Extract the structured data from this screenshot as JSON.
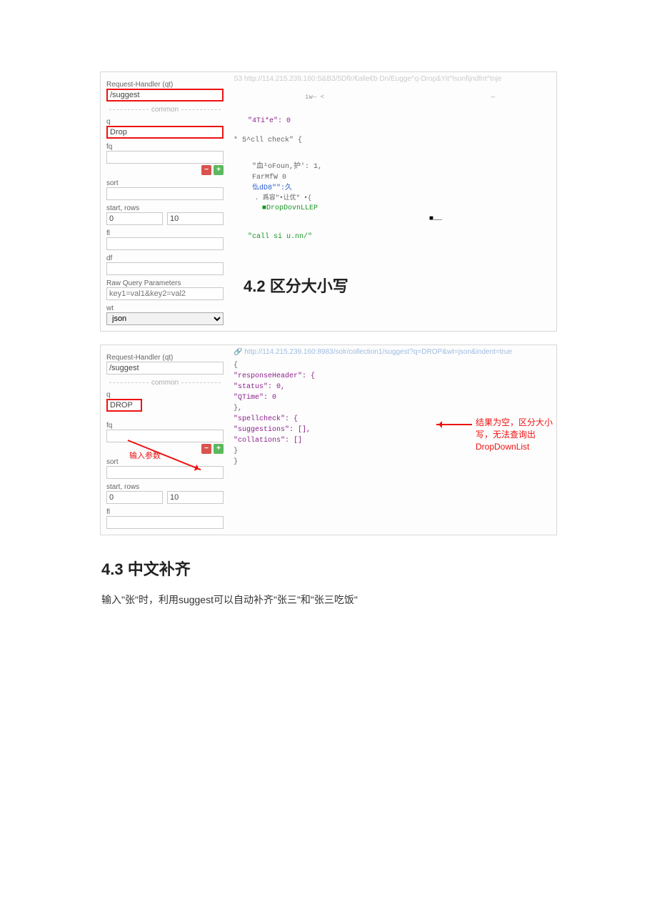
{
  "shot1": {
    "side": {
      "rh_label": "Request-Handler (qt)",
      "rh_value": "/suggest",
      "common": "common",
      "q_label": "q",
      "q_value": "Drop",
      "fq_label": "fq",
      "sort_label": "sort",
      "startrows_label": "start, rows",
      "start_value": "0",
      "rows_value": "10",
      "fl_label": "fl",
      "df_label": "df",
      "rawq_label": "Raw Query Parameters",
      "rawq_ph": "key1=val1&key2=val2",
      "wt_label": "wt",
      "wt_value": "json"
    },
    "right": {
      "url": "S3 http://114.215.239.160:S&B3/5Dflr/€alle€b Dn/Eugge^q-Drop&Yit^lsonfijndfnt^tnje",
      "line_iw": "iw— <",
      "line_dash": "—",
      "t4ti": "\"4Ti*e\":  0",
      "spellcheck": "* 5^cll check\" {",
      "xue": "\"血¹oFoun,护': 1,",
      "farmfw": "FarMfW 0",
      "fud": "仫dD8\"\":久",
      "sug": ". 爲容\"•让优\"  •{",
      "drop": "■DropDovnLLEP",
      "blk": "■……",
      "coll": "\"call si u.nn/\""
    },
    "h42": "4.2 区分大小写"
  },
  "shot2": {
    "side": {
      "rh_label": "Request-Handler (qt)",
      "rh_value": "/suggest",
      "common": "common",
      "q_label": "q",
      "q_value": "DROP",
      "fq_label": "fq",
      "sort_label": "sort",
      "startrows_label": "start, rows",
      "start_value": "0",
      "rows_value": "10",
      "fl_label": "fl"
    },
    "right": {
      "url": "http://114.215.239.160:8983/solr/collection1/suggest?q=DROP&wt=json&indent=true",
      "json": {
        "l1": "{",
        "l2": "  \"responseHeader\": {",
        "l3": "    \"status\": 0,",
        "l4": "    \"QTime\": 0",
        "l5": "  },",
        "l6": "  \"spellcheck\": {",
        "l7": "    \"suggestions\": [],",
        "l8": "    \"collations\": []",
        "l9": "  }",
        "l10": "}"
      },
      "annot_left": "输入参数",
      "annot_right_1": "结果为空，区分大小写，无法查询出",
      "annot_right_2": "DropDownList"
    }
  },
  "section43": {
    "heading": "4.3 中文补齐",
    "para": "输入\"张\"时，利用suggest可以自动补齐\"张三\"和\"张三吃饭\""
  }
}
